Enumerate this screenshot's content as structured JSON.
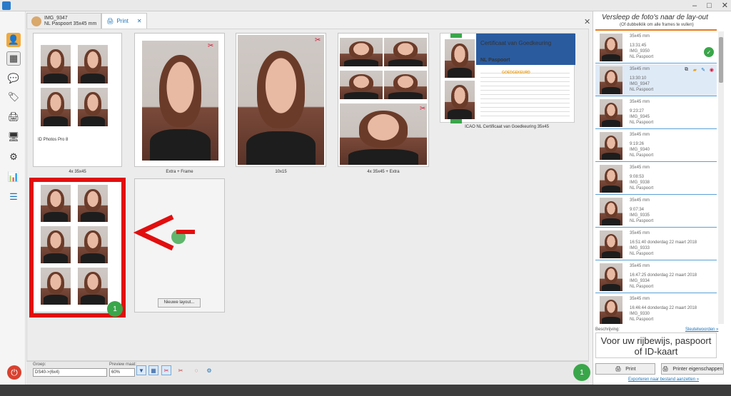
{
  "window": {
    "minimize": "–",
    "maximize": "□",
    "close": "✕"
  },
  "tabs": [
    {
      "line1": "IMG_9347",
      "line2": "NL Paspoort 35x45 mm"
    },
    {
      "label": "Print",
      "close": "✕"
    }
  ],
  "main_close": "✕",
  "layouts": [
    {
      "caption": "4x 35x45",
      "footer": "ID Photos Pro 8"
    },
    {
      "caption": "Extra + Frame"
    },
    {
      "caption": "10x15"
    },
    {
      "caption": "4x 35x45 + Extra"
    },
    {
      "caption": "ICAO NL Certificaat van Goedkeuring 35x45"
    }
  ],
  "new_layout_button": "Nieuwe layout...",
  "certificate": {
    "title": "Certificaat van Goedkeuring",
    "subtitle": "NL Paspoort",
    "approved": "GOEDGEKEURD"
  },
  "badges": {
    "layout_badge": "1",
    "canvas_badge": "1"
  },
  "bottom": {
    "group_label": "Groep:",
    "group_value": "DS40->(6x4)",
    "preview_label": "Preview maat:",
    "preview_value": "60%"
  },
  "right_panel": {
    "title": "Versleep de foto's naar de lay-out",
    "subtitle": "(Of dubbelklik om alle frames te vullen)",
    "items": [
      {
        "size": "35x45 mm",
        "time": "13:31:45",
        "name": "IMG_9350",
        "type": "NL Paspoort"
      },
      {
        "size": "35x45 mm",
        "time": "13:30:10",
        "name": "IMG_9347",
        "type": "NL Paspoort"
      },
      {
        "size": "35x45 mm",
        "time": "9:23:27",
        "name": "IMG_9345",
        "type": "NL Paspoort"
      },
      {
        "size": "35x45 mm",
        "time": "9:19:26",
        "name": "IMG_9340",
        "type": "NL Paspoort"
      },
      {
        "size": "35x45 mm",
        "time": "9:08:53",
        "name": "IMG_9338",
        "type": "NL Paspoort"
      },
      {
        "size": "35x45 mm",
        "time": "9:07:34",
        "name": "IMG_9335",
        "type": "NL Paspoort"
      },
      {
        "size": "35x45 mm",
        "time": "16:51:40  donderdag 22 maart 2018",
        "name": "IMG_9333",
        "type": "NL Paspoort"
      },
      {
        "size": "35x45 mm",
        "time": "16:47:25  donderdag 22 maart 2018",
        "name": "IMG_9334",
        "type": "NL Paspoort"
      },
      {
        "size": "35x45 mm",
        "time": "16:46:44  donderdag 22 maart 2018",
        "name": "IMG_9330",
        "type": "NL Paspoort"
      }
    ],
    "desc_label": "Beschrijving:",
    "desc_link": "Sleutelwoorden »",
    "desc_text": "Voor uw rijbewijs, paspoort of ID-kaart",
    "print_button": "Print",
    "printer_button": "Printer eigenschappen",
    "export_link": "Exporteren naar bestand aanzetten »"
  }
}
